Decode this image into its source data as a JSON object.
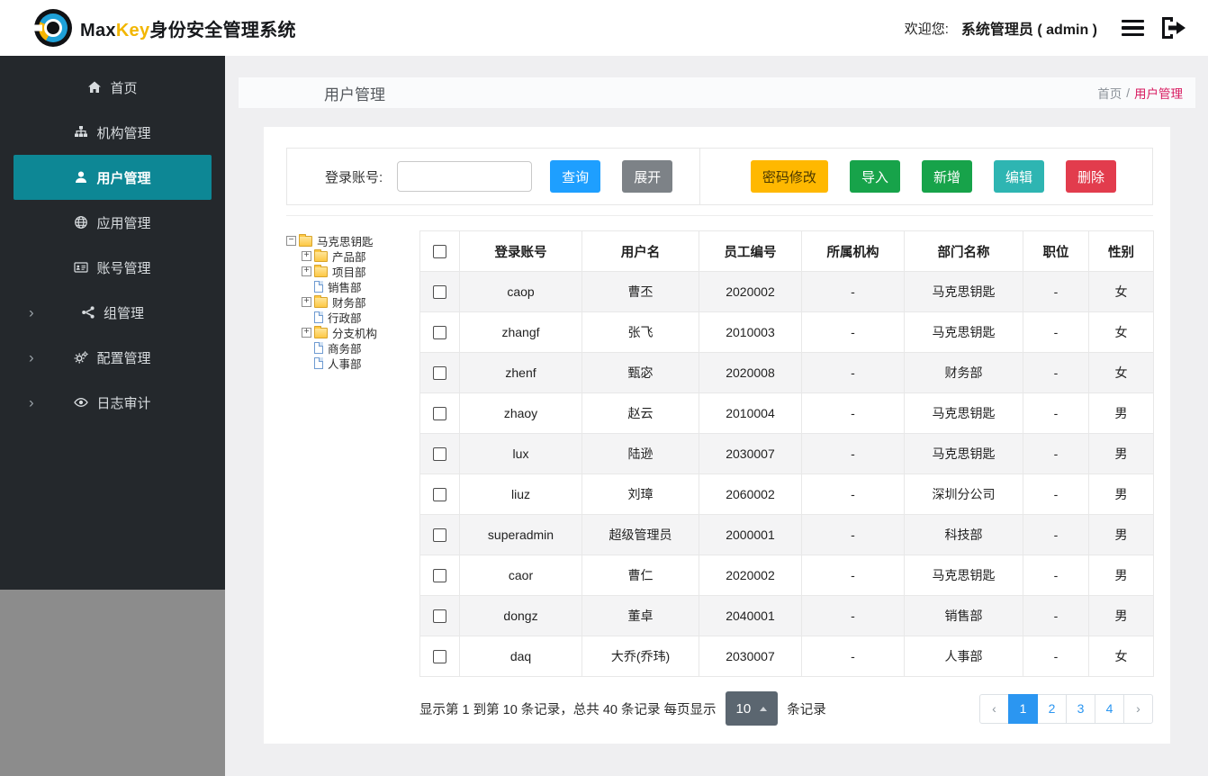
{
  "header": {
    "brand_max": "Max",
    "brand_key": "Key",
    "brand_suffix": "身份安全管理系统",
    "welcome": "欢迎您:",
    "user": "系统管理员 ( admin )",
    "icons": [
      "menu-icon",
      "logout-icon"
    ]
  },
  "sidebar": {
    "items": [
      {
        "key": "home",
        "label": "首页",
        "icon": "home-icon",
        "active": false,
        "chevron": false
      },
      {
        "key": "org",
        "label": "机构管理",
        "icon": "sitemap-icon",
        "active": false,
        "chevron": false
      },
      {
        "key": "user",
        "label": "用户管理",
        "icon": "user-icon",
        "active": true,
        "chevron": false
      },
      {
        "key": "app",
        "label": "应用管理",
        "icon": "globe-icon",
        "active": false,
        "chevron": false
      },
      {
        "key": "account",
        "label": "账号管理",
        "icon": "id-card-icon",
        "active": false,
        "chevron": false
      },
      {
        "key": "group",
        "label": "组管理",
        "icon": "share-nodes-icon",
        "active": false,
        "chevron": true
      },
      {
        "key": "config",
        "label": "配置管理",
        "icon": "gears-icon",
        "active": false,
        "chevron": true
      },
      {
        "key": "audit",
        "label": "日志审计",
        "icon": "eye-icon",
        "active": false,
        "chevron": true
      }
    ]
  },
  "page": {
    "title": "用户管理",
    "breadcrumb_home": "首页",
    "breadcrumb_sep": "/",
    "breadcrumb_current": "用户管理"
  },
  "toolbar": {
    "search_label": "登录账号:",
    "search_value": "",
    "query": "查询",
    "expand": "展开",
    "password": "密码修改",
    "import": "导入",
    "add": "新增",
    "edit": "编辑",
    "delete": "删除"
  },
  "tree": {
    "root": "马克思钥匙",
    "nodes": [
      {
        "label": "产品部",
        "type": "folder",
        "expander": "plus"
      },
      {
        "label": "项目部",
        "type": "folder",
        "expander": "plus"
      },
      {
        "label": "销售部",
        "type": "file"
      },
      {
        "label": "财务部",
        "type": "folder",
        "expander": "plus"
      },
      {
        "label": "行政部",
        "type": "file"
      },
      {
        "label": "分支机构",
        "type": "folder",
        "expander": "plus"
      },
      {
        "label": "商务部",
        "type": "file"
      },
      {
        "label": "人事部",
        "type": "file"
      }
    ]
  },
  "table": {
    "headers": [
      "登录账号",
      "用户名",
      "员工编号",
      "所属机构",
      "部门名称",
      "职位",
      "性别"
    ],
    "rows": [
      [
        "caop",
        "曹丕",
        "2020002",
        "-",
        "马克思钥匙",
        "-",
        "女"
      ],
      [
        "zhangf",
        "张飞",
        "2010003",
        "-",
        "马克思钥匙",
        "-",
        "女"
      ],
      [
        "zhenf",
        "甄宓",
        "2020008",
        "-",
        "财务部",
        "-",
        "女"
      ],
      [
        "zhaoy",
        "赵云",
        "2010004",
        "-",
        "马克思钥匙",
        "-",
        "男"
      ],
      [
        "lux",
        "陆逊",
        "2030007",
        "-",
        "马克思钥匙",
        "-",
        "男"
      ],
      [
        "liuz",
        "刘璋",
        "2060002",
        "-",
        "深圳分公司",
        "-",
        "男"
      ],
      [
        "superadmin",
        "超级管理员",
        "2000001",
        "-",
        "科技部",
        "-",
        "男"
      ],
      [
        "caor",
        "曹仁",
        "2020002",
        "-",
        "马克思钥匙",
        "-",
        "男"
      ],
      [
        "dongz",
        "董卓",
        "2040001",
        "-",
        "销售部",
        "-",
        "男"
      ],
      [
        "daq",
        "大乔(乔玮)",
        "2030007",
        "-",
        "人事部",
        "-",
        "女"
      ]
    ]
  },
  "pagination": {
    "summary_prefix": "显示第 1 到第 10 条记录，总共 40 条记录 每页显示",
    "page_size": "10",
    "summary_suffix": "条记录",
    "prev": "‹",
    "next": "›",
    "pages": [
      "1",
      "2",
      "3",
      "4"
    ],
    "active_page": "1"
  },
  "colors": {
    "sidebar_bg": "#24282c",
    "sidebar_active_teal": "#0d8795",
    "brand_yellow": "#f2b600",
    "breadcrumb_pink": "#d81b60",
    "query_blue": "#1e9fff",
    "expand_gray": "#7d8287",
    "password_yellow": "#ffb800",
    "import_green": "#17a34a",
    "edit_teal": "#2eb5b2",
    "delete_red": "#e23c4d",
    "pagination_blue": "#2b96f1",
    "page_size_dark": "#5b6670"
  }
}
